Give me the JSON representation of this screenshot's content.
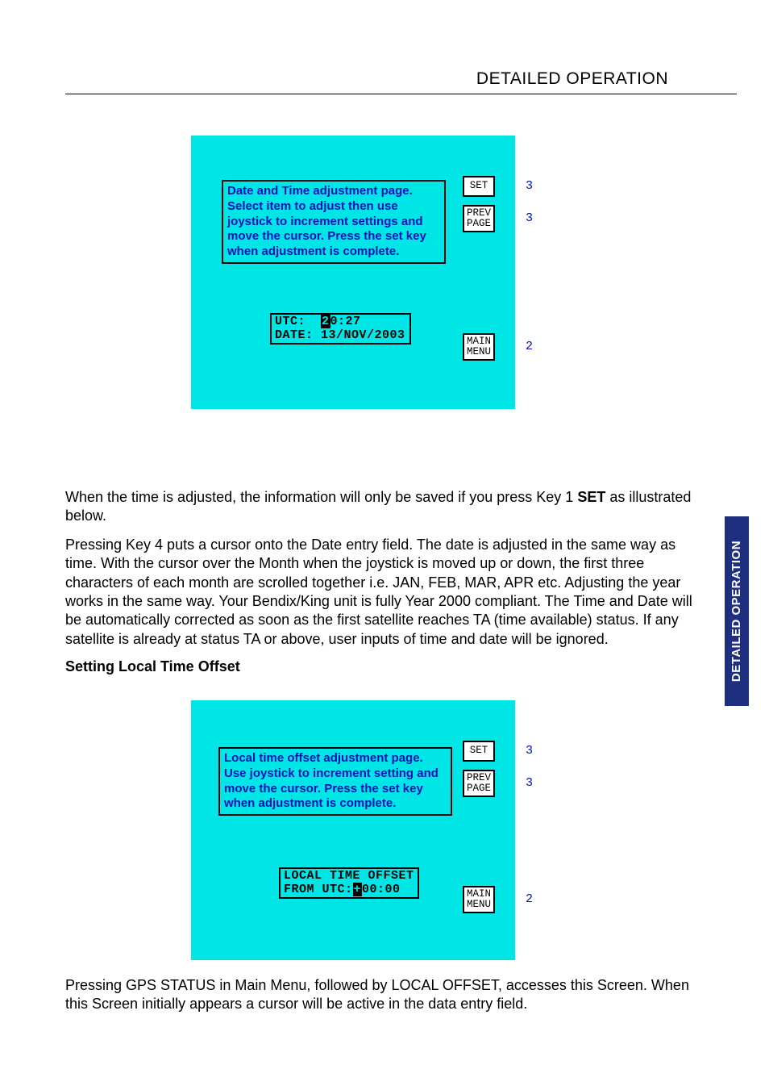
{
  "header": {
    "title": "DETAILED OPERATION"
  },
  "sideTab": {
    "label": "DETAILED OPERATION"
  },
  "screen1": {
    "instructions": "Date and Time adjustment page. Select item to adjust then use joystick to increment settings and move the cursor. Press the set key when adjustment is complete.",
    "utc": {
      "label": "UTC:",
      "cursor_digit": "2",
      "rest": "0:27"
    },
    "date": {
      "label": "DATE:",
      "value": "13/NOV/2003"
    },
    "keys": {
      "set": {
        "label": "SET",
        "num": "3"
      },
      "prev": {
        "line1": "PREV",
        "line2": "PAGE",
        "num": "3"
      },
      "main": {
        "line1": "MAIN",
        "line2": "MENU",
        "num": "2"
      }
    }
  },
  "body": {
    "p1_a": "When the time is adjusted, the information will only be saved if you press Key 1 ",
    "p1_b": "SET",
    "p1_c": " as illustrated below.",
    "p2": "Pressing Key 4 puts a cursor onto the Date entry field.  The date is adjusted in the same way as time. With the cursor over the Month when the joystick is moved up or down, the first three characters of each month are scrolled together i.e. JAN, FEB, MAR, APR etc.  Adjusting the year works in the same way.  Your Bendix/King unit is fully Year 2000 compliant. The Time and Date will be automatically corrected as soon as the first satellite reaches TA (time available) status.  If any satellite is already at status TA or above, user inputs of time and date will be ignored.",
    "h2": "Setting Local Time Offset",
    "p3": "Pressing GPS STATUS in Main Menu, followed by LOCAL OFFSET, accesses this Screen.  When this Screen initially appears a cursor will be active in the data entry field."
  },
  "screen2": {
    "instructions": "Local time offset adjustment page. Use joystick to increment setting and move the cursor. Press the set key when adjustment is complete.",
    "offset": {
      "line1": "LOCAL TIME OFFSET",
      "line2_a": "FROM UTC:",
      "cursor": "+",
      "line2_b": "00:00"
    },
    "keys": {
      "set": {
        "label": "SET",
        "num": "3"
      },
      "prev": {
        "line1": "PREV",
        "line2": "PAGE",
        "num": "3"
      },
      "main": {
        "line1": "MAIN",
        "line2": "MENU",
        "num": "2"
      }
    }
  }
}
